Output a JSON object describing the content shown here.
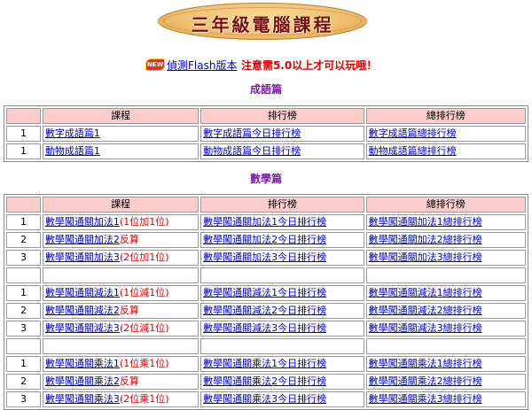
{
  "banner": {
    "title": "三年級電腦課程"
  },
  "notice": {
    "badge": "NEW",
    "link": "偵測Flash版本",
    "warning": "注意需5.0以上才可以玩哦！"
  },
  "headers": {
    "course": "課程",
    "rank": "排行榜",
    "total": "總排行榜"
  },
  "idiom": {
    "title": "成語篇",
    "rows": [
      {
        "num": "1",
        "course": "數字成語篇1",
        "note": "",
        "rank": "數字成語篇今日排行榜",
        "total": "數字成語篇總排行榜"
      },
      {
        "num": "1",
        "course": "動物成語篇1",
        "note": "",
        "rank": "動物成語篇今日排行榜",
        "total": "動物成語篇總排行榜"
      }
    ]
  },
  "math": {
    "title": "數學篇",
    "add": [
      {
        "num": "1",
        "course": "數學闖通關加法1",
        "note": "(1位加1位)",
        "rank": "數學闖通關加法1今日排行榜",
        "total": "數學闖通關加法1總排行榜"
      },
      {
        "num": "2",
        "course": "數學闖通關加法2",
        "note": "反算",
        "rank": "數學闖通關加法2今日排行榜",
        "total": "數學闖通關加法2總排行榜"
      },
      {
        "num": "3",
        "course": "數學闖通關加法3",
        "note": "(2位加1位)",
        "rank": "數學闖通關加法3今日排行榜",
        "total": "數學闖通關加法3總排行榜"
      }
    ],
    "sub": [
      {
        "num": "1",
        "course": "數學闖通關減法1",
        "note": "(1位減1位)",
        "rank": "數學闖通關減法1今日排行榜",
        "total": "數學闖通關減法1總排行榜"
      },
      {
        "num": "2",
        "course": "數學闖通關減法2",
        "note": "反算",
        "rank": "數學闖通關減法2今日排行榜",
        "total": "數學闖通關減法2總排行榜"
      },
      {
        "num": "3",
        "course": "數學闖通關減法3",
        "note": "(2位減1位)",
        "rank": "數學闖通關減法3今日排行榜",
        "total": "數學闖通關減法3總排行榜"
      }
    ],
    "mul": [
      {
        "num": "1",
        "course": "數學闖通關乘法1",
        "note": "(1位乘1位)",
        "rank": "數學闖通關乘法1今日排行榜",
        "total": "數學闖通關乘法1總排行榜"
      },
      {
        "num": "2",
        "course": "數學闖通關乘法2",
        "note": "反算",
        "rank": "數學闖通關乘法2今日排行榜",
        "total": "數學闖通關乘法2總排行榜"
      },
      {
        "num": "3",
        "course": "數學闖通關乘法3",
        "note": "(2位乘1位)",
        "rank": "數學闖通關乘法3今日排行榜",
        "total": "數學闖通關乘法3總排行榜"
      }
    ]
  }
}
